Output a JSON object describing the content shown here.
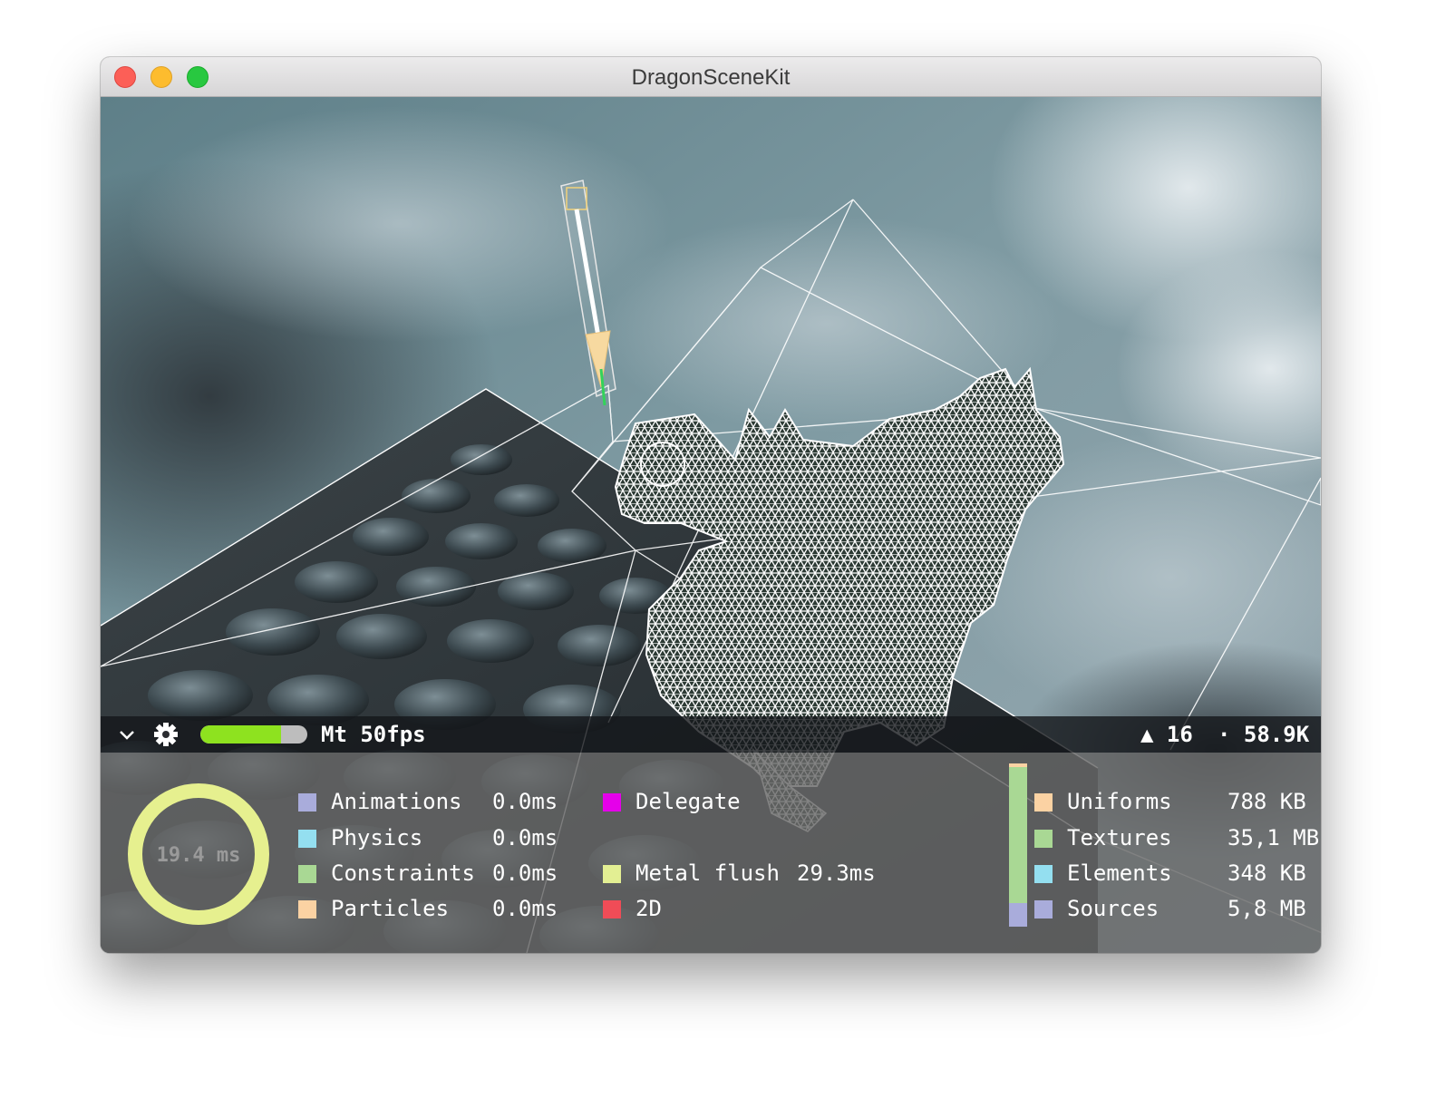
{
  "window": {
    "title": "DragonSceneKit"
  },
  "stats_bar": {
    "fps_label": "Mt 50fps",
    "fps_fraction": 0.75,
    "triangles": "▲ 16",
    "vertices": "· 58.9K"
  },
  "frame_time": "19.4 ms",
  "timings": [
    {
      "name": "Animations",
      "value": "0.0ms",
      "color": "#a9acdb"
    },
    {
      "name": "Physics",
      "value": "0.0ms",
      "color": "#94dff0"
    },
    {
      "name": "Constraints",
      "value": "0.0ms",
      "color": "#a9d894"
    },
    {
      "name": "Particles",
      "value": "0.0ms",
      "color": "#fbd2a3"
    }
  ],
  "timings2": [
    {
      "name": "Delegate",
      "value": "",
      "color": "#e500ea"
    },
    {
      "name": "Metal flush",
      "value": "29.3ms",
      "color": "#e3ef93"
    },
    {
      "name": "2D",
      "value": "",
      "color": "#f04c57"
    }
  ],
  "memory": [
    {
      "name": "Uniforms",
      "value": "788 KB",
      "color": "#fbd2a3"
    },
    {
      "name": "Textures",
      "value": "35,1 MB",
      "color": "#a9d894"
    },
    {
      "name": "Elements",
      "value": "348 KB",
      "color": "#94dff0"
    },
    {
      "name": "Sources",
      "value": "5,8 MB",
      "color": "#a9acdb"
    }
  ],
  "colors": {
    "ring": "#e6f08f",
    "fps_fill": "#8ee21f",
    "mem_bar_main": "#a9d894",
    "mem_bar_bottom": "#a9acdb",
    "mem_bar_top": "#fbd2a3"
  }
}
